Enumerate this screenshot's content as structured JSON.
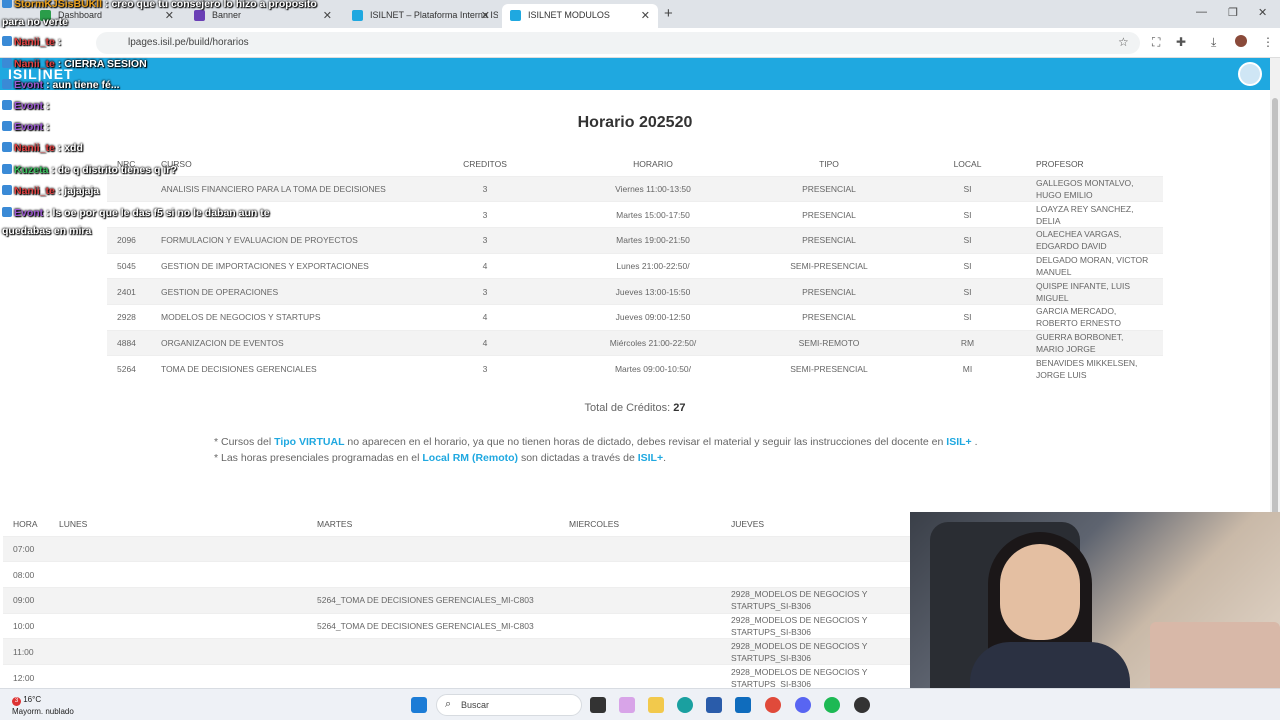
{
  "browser": {
    "tabs": [
      {
        "label": "Dashboard",
        "active": false,
        "favicon_color": "#2a9d4a"
      },
      {
        "label": "Banner",
        "active": false,
        "favicon_color": "#6a3fb5"
      },
      {
        "label": "ISILNET – Plataforma Interna IS",
        "active": false,
        "favicon_color": "#1fa8e0"
      },
      {
        "label": "ISILNET MODULOS",
        "active": true,
        "favicon_color": "#1fa8e0"
      }
    ],
    "url": "lpages.isil.pe/build/horarios"
  },
  "site": {
    "logo": "ISIL|NET",
    "accent": "#1fa8e0"
  },
  "page": {
    "title": "Horario 202520",
    "columns": [
      "NRC",
      "CURSO",
      "CREDITOS",
      "HORARIO",
      "TIPO",
      "LOCAL",
      "PROFESOR"
    ],
    "rows": [
      {
        "nrc": "",
        "curso": "ANALISIS FINANCIERO PARA LA TOMA DE DECISIONES",
        "creditos": "3",
        "horario": "Viernes 11:00-13:50",
        "tipo": "PRESENCIAL",
        "local": "SI",
        "profesor": "GALLEGOS MONTALVO, HUGO EMILIO"
      },
      {
        "nrc": "",
        "curso": "",
        "creditos": "3",
        "horario": "Martes 15:00-17:50",
        "tipo": "PRESENCIAL",
        "local": "SI",
        "profesor": "LOAYZA REY SANCHEZ, DELIA"
      },
      {
        "nrc": "2096",
        "curso": "FORMULACION Y EVALUACION DE PROYECTOS",
        "creditos": "3",
        "horario": "Martes 19:00-21:50",
        "tipo": "PRESENCIAL",
        "local": "SI",
        "profesor": "OLAECHEA VARGAS, EDGARDO DAVID"
      },
      {
        "nrc": "5045",
        "curso": "GESTION DE IMPORTACIONES Y EXPORTACIONES",
        "creditos": "4",
        "horario": "Lunes 21:00-22:50/",
        "tipo": "SEMI-PRESENCIAL",
        "local": "SI",
        "profesor": "DELGADO MORAN, VICTOR MANUEL"
      },
      {
        "nrc": "2401",
        "curso": "GESTION DE OPERACIONES",
        "creditos": "3",
        "horario": "Jueves 13:00-15:50",
        "tipo": "PRESENCIAL",
        "local": "SI",
        "profesor": "QUISPE INFANTE, LUIS MIGUEL"
      },
      {
        "nrc": "2928",
        "curso": "MODELOS DE NEGOCIOS Y STARTUPS",
        "creditos": "4",
        "horario": "Jueves 09:00-12:50",
        "tipo": "PRESENCIAL",
        "local": "SI",
        "profesor": "GARCIA MERCADO, ROBERTO ERNESTO"
      },
      {
        "nrc": "4884",
        "curso": "ORGANIZACION DE EVENTOS",
        "creditos": "4",
        "horario": "Miércoles 21:00-22:50/",
        "tipo": "SEMI-REMOTO",
        "local": "RM",
        "profesor": "GUERRA BORBONET, MARIO JORGE"
      },
      {
        "nrc": "5264",
        "curso": "TOMA DE DECISIONES GERENCIALES",
        "creditos": "3",
        "horario": "Martes 09:00-10:50/",
        "tipo": "SEMI-PRESENCIAL",
        "local": "MI",
        "profesor": "BENAVIDES MIKKELSEN, JORGE LUIS"
      }
    ],
    "total_label": "Total de Créditos:",
    "total_value": "27",
    "note1_a": "* Cursos del ",
    "note1_b": "Tipo VIRTUAL",
    "note1_c": " no aparecen en el horario, ya que no tienen horas de dictado, debes revisar el material y seguir las instrucciones del docente en ",
    "note1_d": "ISIL+",
    "note1_e": " .",
    "note2_a": "* Las horas presenciales programadas en el ",
    "note2_b": "Local RM (Remoto)",
    "note2_c": " son dictadas a través de ",
    "note2_d": "ISIL+",
    "note2_e": "."
  },
  "grid": {
    "columns": [
      "HORA",
      "LUNES",
      "MARTES",
      "MIERCOLES",
      "JUEVES"
    ],
    "rows": [
      {
        "hora": "07:00",
        "lunes": "",
        "martes": "",
        "miercoles": "",
        "jueves": ""
      },
      {
        "hora": "08:00",
        "lunes": "",
        "martes": "",
        "miercoles": "",
        "jueves": ""
      },
      {
        "hora": "09:00",
        "lunes": "",
        "martes": "5264_TOMA DE DECISIONES GERENCIALES_MI-C803",
        "miercoles": "",
        "jueves": "2928_MODELOS DE NEGOCIOS Y STARTUPS_SI-B306"
      },
      {
        "hora": "10:00",
        "lunes": "",
        "martes": "5264_TOMA DE DECISIONES GERENCIALES_MI-C803",
        "miercoles": "",
        "jueves": "2928_MODELOS DE NEGOCIOS Y STARTUPS_SI-B306"
      },
      {
        "hora": "11:00",
        "lunes": "",
        "martes": "",
        "miercoles": "",
        "jueves": "2928_MODELOS DE NEGOCIOS Y STARTUPS_SI-B306"
      },
      {
        "hora": "12:00",
        "lunes": "",
        "martes": "",
        "miercoles": "",
        "jueves": "2928_MODELOS DE NEGOCIOS Y STARTUPS_SI-B306"
      }
    ]
  },
  "chat": [
    {
      "nick": "StormKJSisBUKII",
      "text": " : creo que tu consejero lo hizo a proposito",
      "nick_color": "#e8a020"
    },
    {
      "nick": "",
      "text": "para no verte",
      "nick_color": "#ffffff"
    },
    {
      "nick": "Nanii_te",
      "text": " :",
      "nick_color": "#e04040"
    },
    {
      "nick": "Nanii_te",
      "text": " : CIERRA SESION",
      "nick_color": "#e04040"
    },
    {
      "nick": "Evont",
      "text": " : aun tiene fé...",
      "nick_color": "#9b59d0"
    },
    {
      "nick": "Evont",
      "text": " :",
      "nick_color": "#9b59d0"
    },
    {
      "nick": "Evont",
      "text": " :",
      "nick_color": "#9b59d0"
    },
    {
      "nick": "Nanii_te",
      "text": " : xdd",
      "nick_color": "#e04040"
    },
    {
      "nick": "Kuzeta",
      "text": " : de q distrito tienes q ir?",
      "nick_color": "#3cc060"
    },
    {
      "nick": "Nanii_te",
      "text": " : jajajaja",
      "nick_color": "#e04040"
    },
    {
      "nick": "Evont",
      "text": " : ls oe por que le das f5 si no le daban aun te",
      "nick_color": "#9b59d0"
    },
    {
      "nick": "",
      "text": "quedabas en mira",
      "nick_color": "#ffffff"
    }
  ],
  "taskbar": {
    "temp": "16°C",
    "weather": "Mayorm. nublado",
    "search": "Buscar",
    "notif_count": "3"
  }
}
